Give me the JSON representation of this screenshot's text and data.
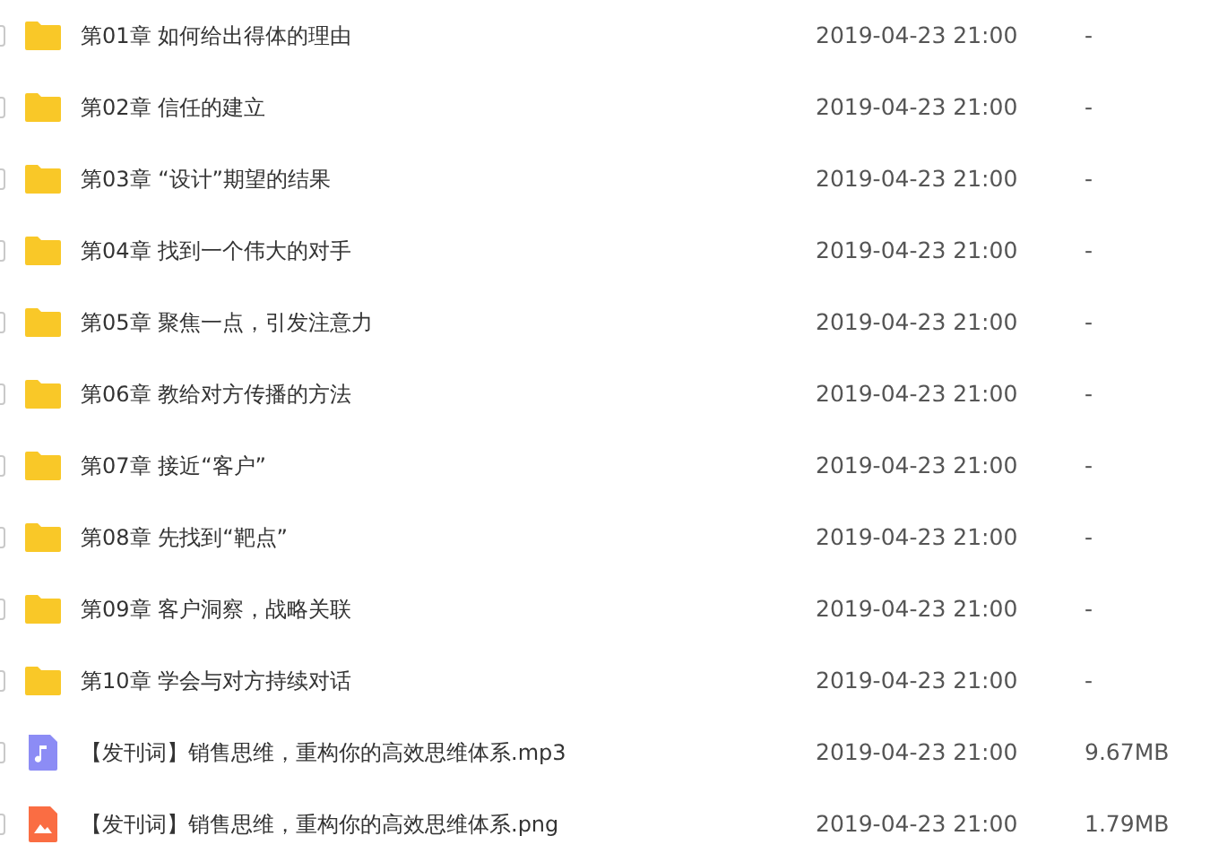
{
  "files": [
    {
      "kind": "folder",
      "name": "第01章 如何给出得体的理由",
      "modified": "2019-04-23 21:00",
      "size": "-",
      "checked": false
    },
    {
      "kind": "folder",
      "name": "第02章 信任的建立",
      "modified": "2019-04-23 21:00",
      "size": "-",
      "checked": false
    },
    {
      "kind": "folder",
      "name": "第03章 “设计”期望的结果",
      "modified": "2019-04-23 21:00",
      "size": "-",
      "checked": false
    },
    {
      "kind": "folder",
      "name": "第04章 找到一个伟大的对手",
      "modified": "2019-04-23 21:00",
      "size": "-",
      "checked": false
    },
    {
      "kind": "folder",
      "name": "第05章 聚焦一点，引发注意力",
      "modified": "2019-04-23 21:00",
      "size": "-",
      "checked": false
    },
    {
      "kind": "folder",
      "name": "第06章 教给对方传播的方法",
      "modified": "2019-04-23 21:00",
      "size": "-",
      "checked": false
    },
    {
      "kind": "folder",
      "name": "第07章 接近“客户”",
      "modified": "2019-04-23 21:00",
      "size": "-",
      "checked": false
    },
    {
      "kind": "folder",
      "name": "第08章 先找到“靶点”",
      "modified": "2019-04-23 21:00",
      "size": "-",
      "checked": false
    },
    {
      "kind": "folder",
      "name": "第09章 客户洞察，战略关联",
      "modified": "2019-04-23 21:00",
      "size": "-",
      "checked": false
    },
    {
      "kind": "folder",
      "name": "第10章 学会与对方持续对话",
      "modified": "2019-04-23 21:00",
      "size": "-",
      "checked": false
    },
    {
      "kind": "audio",
      "name": "【发刊词】销售思维，重构你的高效思维体系.mp3",
      "modified": "2019-04-23 21:00",
      "size": "9.67MB",
      "checked": false
    },
    {
      "kind": "image",
      "name": "【发刊词】销售思维，重构你的高效思维体系.png",
      "modified": "2019-04-23 21:00",
      "size": "1.79MB",
      "checked": false
    }
  ]
}
